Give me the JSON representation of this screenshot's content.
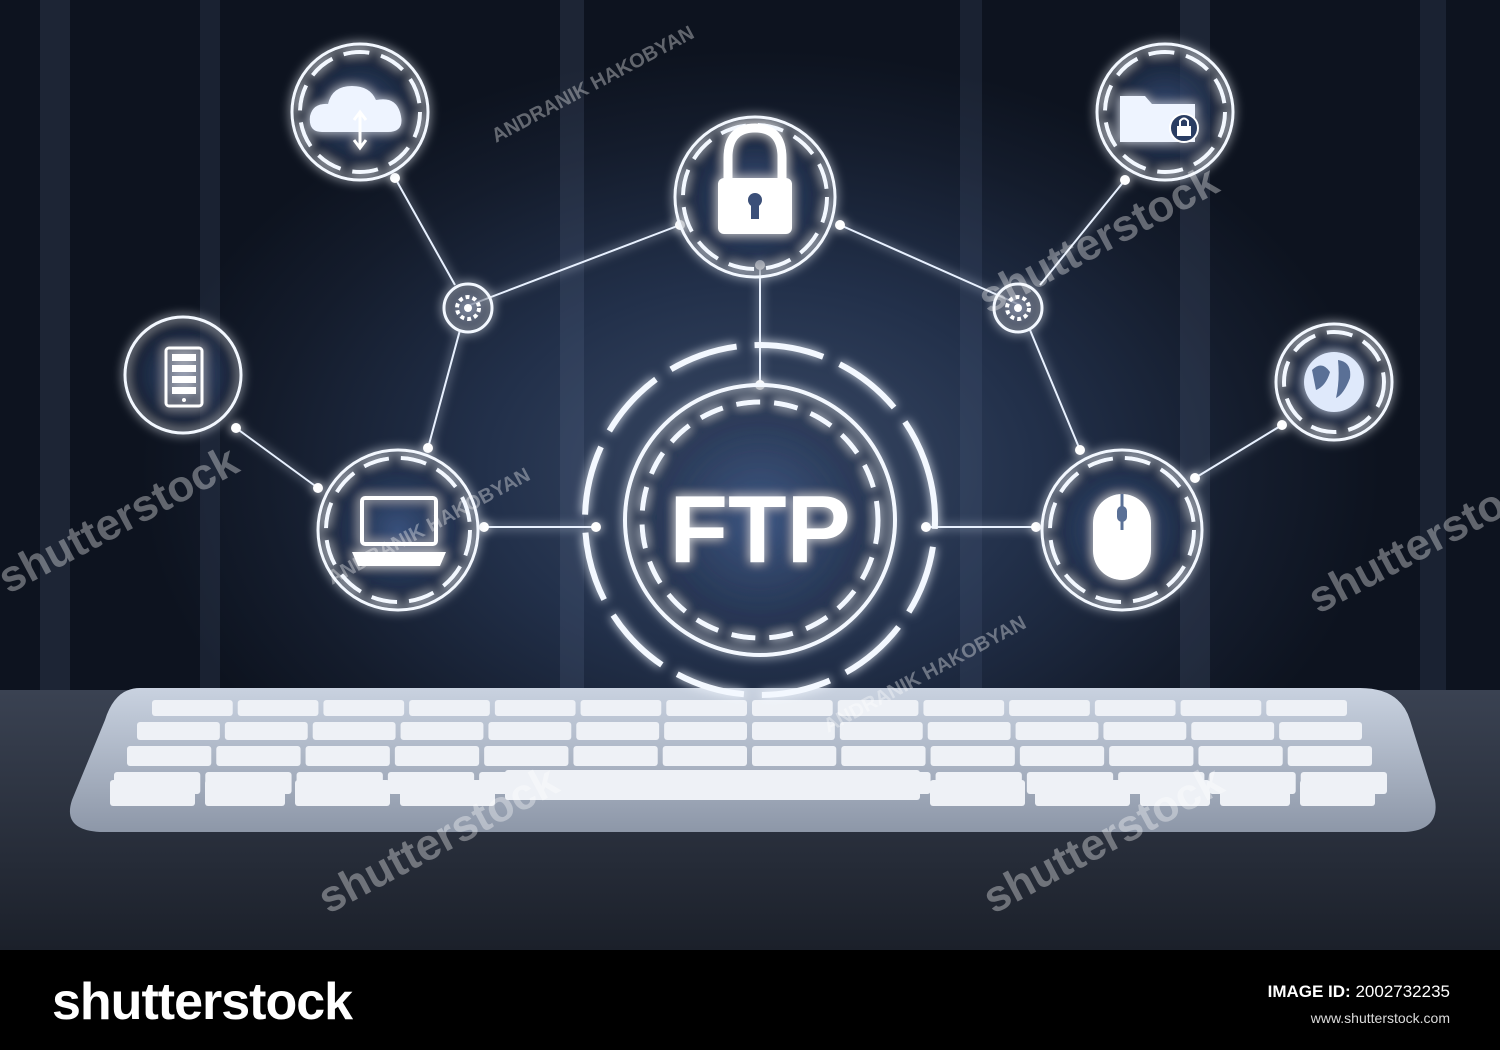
{
  "center_label": "FTP",
  "icons": {
    "center": "ftp-hub-icon",
    "top": "padlock-icon",
    "top_left": "cloud-transfer-icon",
    "top_right": "locked-folder-icon",
    "left": "server-rack-icon",
    "bottom_left": "laptop-icon",
    "bottom_right": "computer-mouse-icon",
    "right": "globe-icon",
    "gear": "gear-icon"
  },
  "watermark": {
    "brand": "shutterstock",
    "author": "ANDRANIK HAKOBYAN"
  },
  "footer": {
    "brand": "shutterstock",
    "id_label": "IMAGE ID:",
    "id_value": "2002732235",
    "url": "www.shutterstock.com"
  },
  "colors": {
    "glow": "#7fb3ff",
    "line": "#e8f1ff",
    "background": "#1a2438",
    "footer": "#000000"
  }
}
